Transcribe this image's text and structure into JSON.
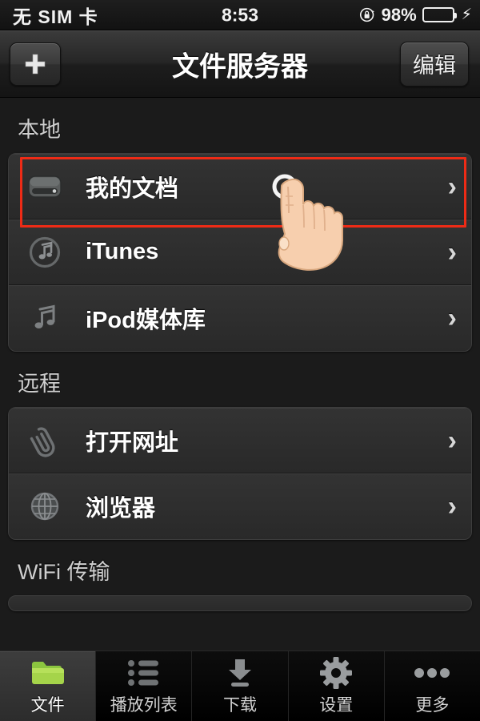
{
  "status_bar": {
    "carrier": "无 SIM 卡",
    "time": "8:53",
    "rotation_lock_icon": "rotation-lock-icon",
    "battery_percent": "98%",
    "battery_level": 98,
    "battery_color": "#4ee34e",
    "charging_icon": "lightning-bolt-icon"
  },
  "nav_bar": {
    "add_label": "+",
    "add_icon": "plus-icon",
    "title": "文件服务器",
    "edit_label": "编辑"
  },
  "sections": [
    {
      "header": "本地",
      "rows": [
        {
          "icon": "hard-drive-icon",
          "label": "我的文档",
          "chevron": "›",
          "highlighted": true
        },
        {
          "icon": "itunes-icon",
          "label": "iTunes",
          "chevron": "›",
          "highlighted": false
        },
        {
          "icon": "music-note-icon",
          "label": "iPod媒体库",
          "chevron": "›",
          "highlighted": false
        }
      ]
    },
    {
      "header": "远程",
      "rows": [
        {
          "icon": "paperclip-icon",
          "label": "打开网址",
          "chevron": "›",
          "highlighted": false
        },
        {
          "icon": "globe-icon",
          "label": "浏览器",
          "chevron": "›",
          "highlighted": false
        }
      ]
    },
    {
      "header": "WiFi 传输",
      "rows": []
    }
  ],
  "annotation": {
    "type": "red-rectangle",
    "color": "#ee2b16",
    "targets": "我的文档",
    "cursor": "pointing-hand-cursor"
  },
  "tab_bar": {
    "items": [
      {
        "icon": "folder-icon",
        "label": "文件",
        "active": true,
        "color": "#8dc63f"
      },
      {
        "icon": "playlist-icon",
        "label": "播放列表",
        "active": false,
        "color": "#7a7a7a"
      },
      {
        "icon": "download-icon",
        "label": "下载",
        "active": false,
        "color": "#9a9a9a"
      },
      {
        "icon": "gear-icon",
        "label": "设置",
        "active": false,
        "color": "#a0a0a0"
      },
      {
        "icon": "more-dots-icon",
        "label": "更多",
        "active": false,
        "color": "#a0a0a0"
      }
    ]
  }
}
